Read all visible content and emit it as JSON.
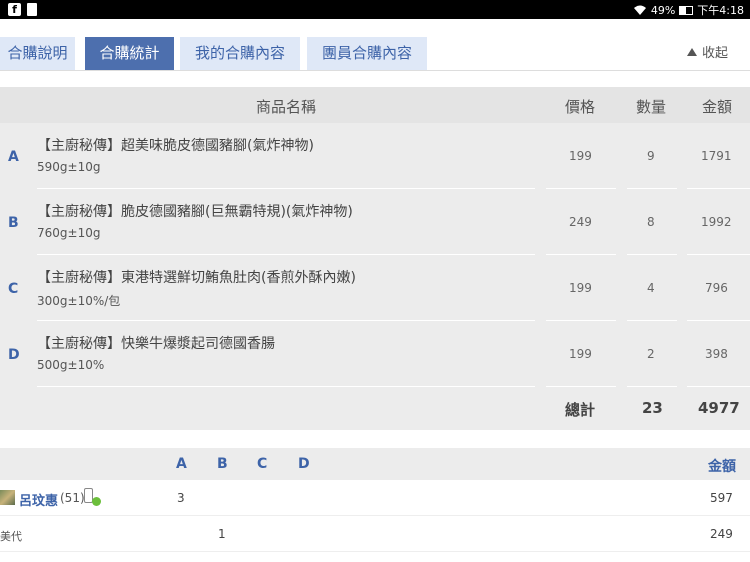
{
  "statusbar": {
    "fb_icon": "f",
    "battery": "49%",
    "time": "下午4:18"
  },
  "tabs": [
    {
      "label": "合購說明"
    },
    {
      "label": "合購統計"
    },
    {
      "label": "我的合購內容"
    },
    {
      "label": "團員合購內容"
    }
  ],
  "collapse_label": "收起",
  "table": {
    "headers": {
      "name": "商品名稱",
      "price": "價格",
      "qty": "數量",
      "amount": "金額"
    },
    "rows": [
      {
        "letter": "A",
        "name": "【主廚秘傳】超美味脆皮德國豬腳(氣炸神物)",
        "spec": "590g±10g",
        "price": "199",
        "qty": "9",
        "amount": "1791"
      },
      {
        "letter": "B",
        "name": "【主廚秘傳】脆皮德國豬腳(巨無霸特規)(氣炸神物)",
        "spec": "760g±10g",
        "price": "249",
        "qty": "8",
        "amount": "1992"
      },
      {
        "letter": "C",
        "name": "【主廚秘傳】東港特選鮮切鮪魚肚肉(香煎外酥內嫩)",
        "spec": "300g±10%/包",
        "price": "199",
        "qty": "4",
        "amount": "796"
      },
      {
        "letter": "D",
        "name": "【主廚秘傳】快樂牛爆漿起司德國香腸",
        "spec": "500g±10%",
        "price": "199",
        "qty": "2",
        "amount": "398"
      }
    ],
    "totals": {
      "label": "總計",
      "qty": "23",
      "amount": "4977"
    }
  },
  "members": {
    "headers": {
      "a": "A",
      "b": "B",
      "c": "C",
      "d": "D",
      "amount": "金額"
    },
    "rows": [
      {
        "name": "呂玟惠",
        "count": "(51)",
        "a": "3",
        "b": "",
        "amount": "597"
      },
      {
        "name": "美代",
        "count": "",
        "a": "",
        "b": "1",
        "amount": "249"
      }
    ]
  },
  "colors": {
    "accent": "#3d63a8",
    "active_tab": "#4d6fae",
    "tab_bg": "#dfe8f7"
  }
}
